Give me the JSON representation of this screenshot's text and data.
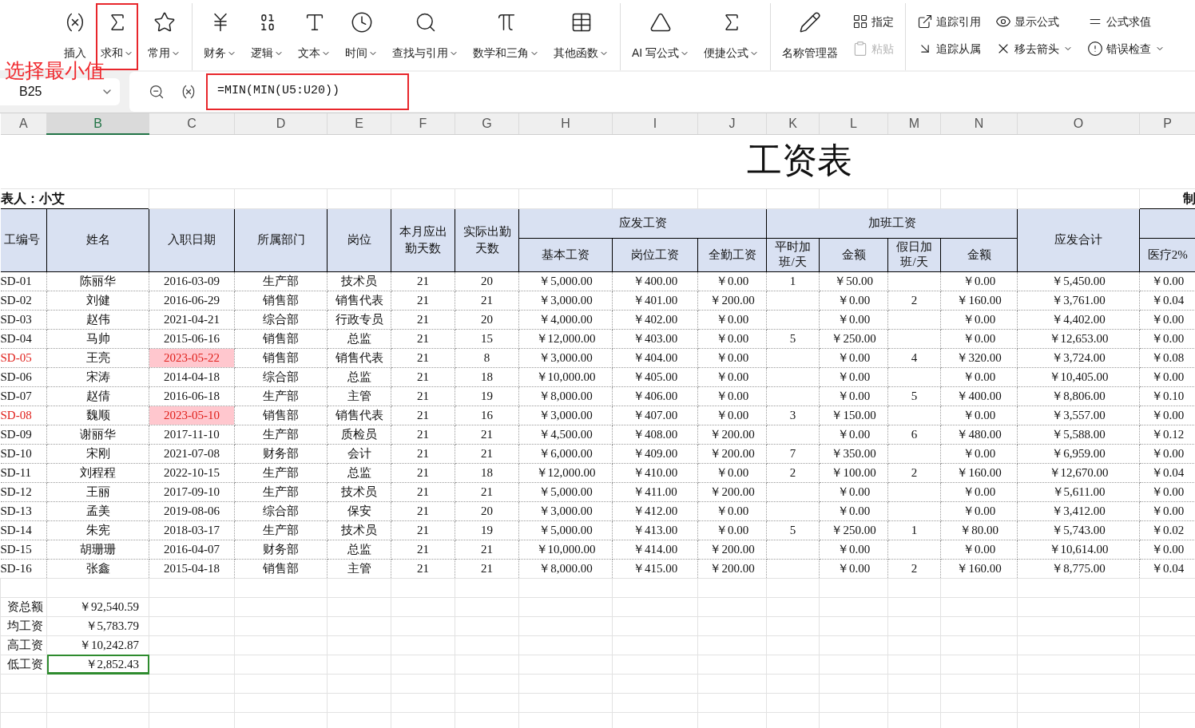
{
  "ribbon": {
    "groups": [
      {
        "items": [
          {
            "label": "插入",
            "kind": "large",
            "has_menu": false,
            "highlighted": false,
            "disabled": false
          },
          {
            "label": "求和",
            "kind": "large",
            "has_menu": true,
            "highlighted": true,
            "disabled": false
          },
          {
            "label": "常用",
            "kind": "large",
            "has_menu": true,
            "highlighted": false,
            "disabled": false
          }
        ]
      },
      {
        "items": [
          {
            "label": "财务",
            "kind": "large",
            "has_menu": true,
            "highlighted": false,
            "disabled": false
          },
          {
            "label": "逻辑",
            "kind": "large",
            "has_menu": true,
            "highlighted": false,
            "disabled": false
          },
          {
            "label": "文本",
            "kind": "large",
            "has_menu": true,
            "highlighted": false,
            "disabled": false
          },
          {
            "label": "时间",
            "kind": "large",
            "has_menu": true,
            "highlighted": false,
            "disabled": false
          },
          {
            "label": "查找与引用",
            "kind": "large",
            "has_menu": true,
            "highlighted": false,
            "disabled": false
          },
          {
            "label": "数学和三角",
            "kind": "large",
            "has_menu": true,
            "highlighted": false,
            "disabled": false
          },
          {
            "label": "其他函数",
            "kind": "large",
            "has_menu": true,
            "highlighted": false,
            "disabled": false
          }
        ]
      },
      {
        "items": [
          {
            "label": "AI 写公式",
            "kind": "large",
            "has_menu": true,
            "highlighted": false,
            "disabled": false
          },
          {
            "label": "便捷公式",
            "kind": "large",
            "has_menu": true,
            "highlighted": false,
            "disabled": false
          }
        ]
      },
      {
        "items": [
          {
            "label": "名称管理器",
            "kind": "large",
            "has_menu": false,
            "highlighted": false,
            "disabled": false
          },
          {
            "label": "指定",
            "kind": "small",
            "has_menu": false,
            "highlighted": false,
            "disabled": false
          },
          {
            "label": "粘贴",
            "kind": "small",
            "has_menu": false,
            "highlighted": false,
            "disabled": true
          }
        ]
      },
      {
        "items": [
          {
            "label": "追踪引用",
            "kind": "small",
            "has_menu": false,
            "highlighted": false,
            "disabled": false
          },
          {
            "label": "追踪从属",
            "kind": "small",
            "has_menu": false,
            "highlighted": false,
            "disabled": false
          },
          {
            "label": "显示公式",
            "kind": "small",
            "has_menu": false,
            "highlighted": false,
            "disabled": false
          },
          {
            "label": "移去箭头",
            "kind": "small",
            "has_menu": true,
            "highlighted": false,
            "disabled": false
          },
          {
            "label": "公式求值",
            "kind": "small",
            "has_menu": false,
            "highlighted": false,
            "disabled": false
          },
          {
            "label": "错误检查",
            "kind": "small",
            "has_menu": true,
            "highlighted": false,
            "disabled": false
          }
        ]
      }
    ]
  },
  "annotation": {
    "text": "选择最小值"
  },
  "formula_bar": {
    "name_box": "B25",
    "formula": "=MIN(MIN(U5:U20))",
    "highlighted": true
  },
  "columns": [
    {
      "label": "A",
      "selected": false
    },
    {
      "label": "B",
      "selected": true
    },
    {
      "label": "C",
      "selected": false
    },
    {
      "label": "D",
      "selected": false
    },
    {
      "label": "E",
      "selected": false
    },
    {
      "label": "F",
      "selected": false
    },
    {
      "label": "G",
      "selected": false
    },
    {
      "label": "H",
      "selected": false
    },
    {
      "label": "I",
      "selected": false
    },
    {
      "label": "J",
      "selected": false
    },
    {
      "label": "K",
      "selected": false
    },
    {
      "label": "L",
      "selected": false
    },
    {
      "label": "M",
      "selected": false
    },
    {
      "label": "N",
      "selected": false
    },
    {
      "label": "O",
      "selected": false
    },
    {
      "label": "P",
      "selected": false
    }
  ],
  "sheet": {
    "title": "工资表",
    "maker": "表人：小艾",
    "maker_right": "制",
    "header": {
      "single": [
        "工编号",
        "姓名",
        "入职日期",
        "所属部门",
        "岗位",
        "本月应出勤天数",
        "实际出勤天数"
      ],
      "groups": [
        {
          "label": "应发工资",
          "columns": [
            "基本工资",
            "岗位工资",
            "全勤工资"
          ]
        },
        {
          "label": "加班工资",
          "columns": [
            "平时加班/天",
            "金额",
            "假日加班/天",
            "金额"
          ]
        }
      ],
      "total": "应发合计",
      "last": "医疗2%"
    },
    "rows": [
      {
        "flagged": false,
        "cells": [
          "SD-01",
          "陈丽华",
          "2016-03-09",
          "生产部",
          "技术员",
          "21",
          "20",
          "￥5,000.00",
          "￥400.00",
          "￥0.00",
          "1",
          "￥50.00",
          null,
          "￥0.00",
          "￥5,450.00",
          "￥0.00"
        ]
      },
      {
        "flagged": false,
        "cells": [
          "SD-02",
          "刘健",
          "2016-06-29",
          "销售部",
          "销售代表",
          "21",
          "21",
          "￥3,000.00",
          "￥401.00",
          "￥200.00",
          null,
          "￥0.00",
          "2",
          "￥160.00",
          "￥3,761.00",
          "￥0.04"
        ]
      },
      {
        "flagged": false,
        "cells": [
          "SD-03",
          "赵伟",
          "2021-04-21",
          "综合部",
          "行政专员",
          "21",
          "20",
          "￥4,000.00",
          "￥402.00",
          "￥0.00",
          null,
          "￥0.00",
          null,
          "￥0.00",
          "￥4,402.00",
          "￥0.00"
        ]
      },
      {
        "flagged": false,
        "cells": [
          "SD-04",
          "马帅",
          "2015-06-16",
          "销售部",
          "总监",
          "21",
          "15",
          "￥12,000.00",
          "￥403.00",
          "￥0.00",
          "5",
          "￥250.00",
          null,
          "￥0.00",
          "￥12,653.00",
          "￥0.00"
        ]
      },
      {
        "flagged": true,
        "cells": [
          "SD-05",
          "王亮",
          "2023-05-22",
          "销售部",
          "销售代表",
          "21",
          "8",
          "￥3,000.00",
          "￥404.00",
          "￥0.00",
          null,
          "￥0.00",
          "4",
          "￥320.00",
          "￥3,724.00",
          "￥0.08"
        ]
      },
      {
        "flagged": false,
        "cells": [
          "SD-06",
          "宋涛",
          "2014-04-18",
          "综合部",
          "总监",
          "21",
          "18",
          "￥10,000.00",
          "￥405.00",
          "￥0.00",
          null,
          "￥0.00",
          null,
          "￥0.00",
          "￥10,405.00",
          "￥0.00"
        ]
      },
      {
        "flagged": false,
        "cells": [
          "SD-07",
          "赵倩",
          "2016-06-18",
          "生产部",
          "主管",
          "21",
          "19",
          "￥8,000.00",
          "￥406.00",
          "￥0.00",
          null,
          "￥0.00",
          "5",
          "￥400.00",
          "￥8,806.00",
          "￥0.10"
        ]
      },
      {
        "flagged": true,
        "cells": [
          "SD-08",
          "魏顺",
          "2023-05-10",
          "销售部",
          "销售代表",
          "21",
          "16",
          "￥3,000.00",
          "￥407.00",
          "￥0.00",
          "3",
          "￥150.00",
          null,
          "￥0.00",
          "￥3,557.00",
          "￥0.00"
        ]
      },
      {
        "flagged": false,
        "cells": [
          "SD-09",
          "谢丽华",
          "2017-11-10",
          "生产部",
          "质检员",
          "21",
          "21",
          "￥4,500.00",
          "￥408.00",
          "￥200.00",
          null,
          "￥0.00",
          "6",
          "￥480.00",
          "￥5,588.00",
          "￥0.12"
        ]
      },
      {
        "flagged": false,
        "cells": [
          "SD-10",
          "宋刚",
          "2021-07-08",
          "财务部",
          "会计",
          "21",
          "21",
          "￥6,000.00",
          "￥409.00",
          "￥200.00",
          "7",
          "￥350.00",
          null,
          "￥0.00",
          "￥6,959.00",
          "￥0.00"
        ]
      },
      {
        "flagged": false,
        "cells": [
          "SD-11",
          "刘程程",
          "2022-10-15",
          "生产部",
          "总监",
          "21",
          "18",
          "￥12,000.00",
          "￥410.00",
          "￥0.00",
          "2",
          "￥100.00",
          "2",
          "￥160.00",
          "￥12,670.00",
          "￥0.04"
        ]
      },
      {
        "flagged": false,
        "cells": [
          "SD-12",
          "王丽",
          "2017-09-10",
          "生产部",
          "技术员",
          "21",
          "21",
          "￥5,000.00",
          "￥411.00",
          "￥200.00",
          null,
          "￥0.00",
          null,
          "￥0.00",
          "￥5,611.00",
          "￥0.00"
        ]
      },
      {
        "flagged": false,
        "cells": [
          "SD-13",
          "孟美",
          "2019-08-06",
          "综合部",
          "保安",
          "21",
          "20",
          "￥3,000.00",
          "￥412.00",
          "￥0.00",
          null,
          "￥0.00",
          null,
          "￥0.00",
          "￥3,412.00",
          "￥0.00"
        ]
      },
      {
        "flagged": false,
        "cells": [
          "SD-14",
          "朱宪",
          "2018-03-17",
          "生产部",
          "技术员",
          "21",
          "19",
          "￥5,000.00",
          "￥413.00",
          "￥0.00",
          "5",
          "￥250.00",
          "1",
          "￥80.00",
          "￥5,743.00",
          "￥0.02"
        ]
      },
      {
        "flagged": false,
        "cells": [
          "SD-15",
          "胡珊珊",
          "2016-04-07",
          "财务部",
          "总监",
          "21",
          "21",
          "￥10,000.00",
          "￥414.00",
          "￥200.00",
          null,
          "￥0.00",
          null,
          "￥0.00",
          "￥10,614.00",
          "￥0.00"
        ]
      },
      {
        "flagged": false,
        "cells": [
          "SD-16",
          "张鑫",
          "2015-04-18",
          "销售部",
          "主管",
          "21",
          "21",
          "￥8,000.00",
          "￥415.00",
          "￥200.00",
          null,
          "￥0.00",
          "2",
          "￥160.00",
          "￥8,775.00",
          "￥0.04"
        ]
      }
    ],
    "summary": [
      {
        "label": "资总额",
        "value": "￥92,540.59",
        "selected": false
      },
      {
        "label": "均工资",
        "value": "￥5,783.79",
        "selected": false
      },
      {
        "label": "高工资",
        "value": "￥10,242.87",
        "selected": false
      },
      {
        "label": "低工资",
        "value": "￥2,852.43",
        "selected": true
      }
    ]
  }
}
